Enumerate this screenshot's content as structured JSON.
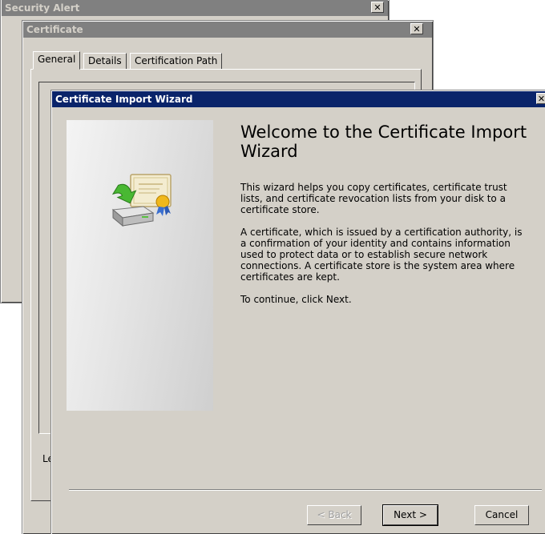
{
  "security_alert": {
    "title": "Security Alert"
  },
  "certificate": {
    "title": "Certificate",
    "tabs": [
      "General",
      "Details",
      "Certification Path"
    ],
    "partial_label": "Le"
  },
  "wizard": {
    "title": "Certificate Import Wizard",
    "heading": "Welcome to the Certificate Import Wizard",
    "paragraphs": [
      "This wizard helps you copy certificates, certificate trust lists, and certificate revocation lists from your disk to a certificate store.",
      "A certificate, which is issued by a certification authority, is a confirmation of your identity and contains information used to protect data or to establish secure network connections. A certificate store is the system area where certificates are kept.",
      "To continue, click Next."
    ],
    "buttons": {
      "back": "< Back",
      "next": "Next >",
      "cancel": "Cancel"
    }
  },
  "icons": {
    "close": "close-icon",
    "certificate": "certificate-import-icon"
  }
}
